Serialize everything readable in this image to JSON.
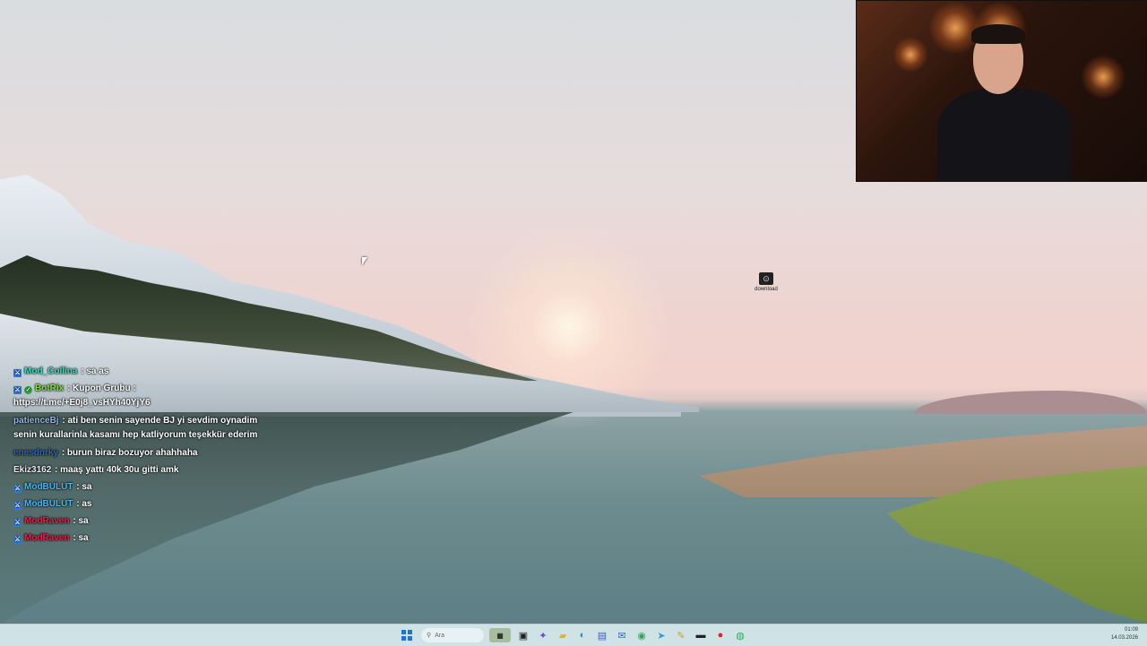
{
  "desktop": {
    "icon_label": "download"
  },
  "chat": {
    "messages": [
      {
        "user": "Mod_Collina",
        "user_color": "#3fd9c0",
        "badges": [
          "mod"
        ],
        "text": ": sa as"
      },
      {
        "user": "BotRix",
        "user_color": "#7fe23a",
        "badges": [
          "mod",
          "verified"
        ],
        "text": ": Kupon Grubu :",
        "text2": "https://t.me/+E0j8_vsHYh40YjY6"
      },
      {
        "user": "patienceBj",
        "user_color": "#8fb4e8",
        "badges": [],
        "text": ": ati ben senin sayende BJ yi sevdim oynadim",
        "text2": "senin kurallarinla kasamı hep katliyorum teşekkür ederim"
      },
      {
        "user": "enesdnrky",
        "user_color": "#2f62c8",
        "badges": [],
        "text": ": burun biraz bozuyor ahahhaha"
      },
      {
        "user": "Ekiz3162",
        "user_color": "#e8e8ee",
        "badges": [],
        "text": ": maaş yattı 40k 30u gitti amk"
      },
      {
        "user": "ModBULUT",
        "user_color": "#49b8f0",
        "badges": [
          "mod"
        ],
        "text": ": sa"
      },
      {
        "user": "ModBULUT",
        "user_color": "#49b8f0",
        "badges": [
          "mod"
        ],
        "text": ": as"
      },
      {
        "user": "ModRaven",
        "user_color": "#e0234d",
        "badges": [
          "mod"
        ],
        "text": ": sa"
      },
      {
        "user": "ModRaven",
        "user_color": "#e0234d",
        "badges": [
          "mod"
        ],
        "text": ": sa"
      }
    ]
  },
  "taskbar": {
    "search_placeholder": "Ara",
    "apps": [
      "widgets-icon",
      "file-explorer-icon",
      "copilot-icon",
      "folder-icon",
      "edge-icon",
      "store-icon",
      "mail-icon",
      "chrome-icon",
      "telegram-icon",
      "notepad-icon",
      "terminal-icon",
      "recorder-icon",
      "spotify-icon"
    ],
    "time": "01:09",
    "date": "14.03.2026"
  }
}
